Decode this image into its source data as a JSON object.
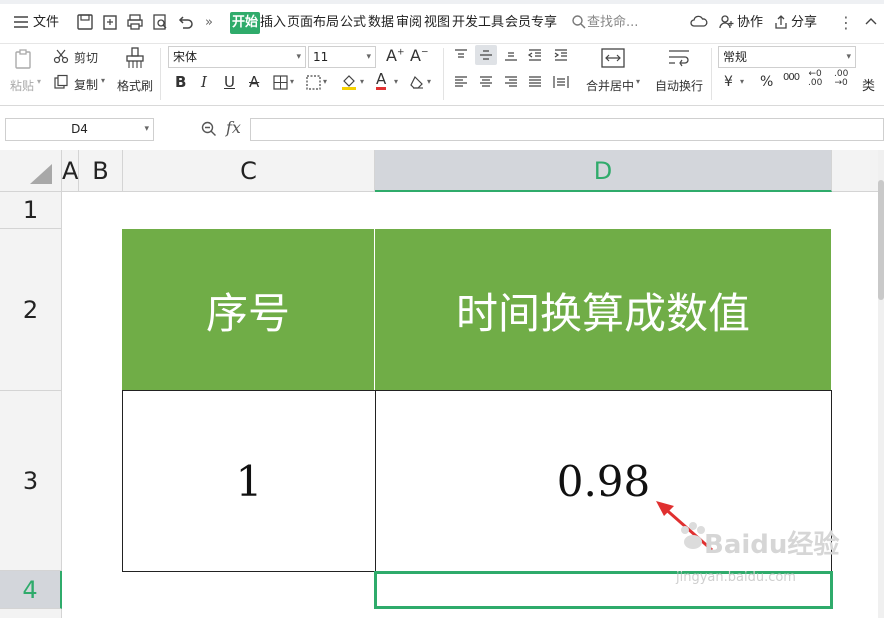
{
  "menubar": {
    "file_label": "文件",
    "more_glyph": "»",
    "tabs": [
      {
        "label": "开始",
        "active": true
      },
      {
        "label": "插入"
      },
      {
        "label": "页面布局"
      },
      {
        "label": "公式"
      },
      {
        "label": "数据"
      },
      {
        "label": "审阅"
      },
      {
        "label": "视图"
      },
      {
        "label": "开发工具"
      },
      {
        "label": "会员专享"
      }
    ],
    "search_placeholder": "查找命...",
    "collab_label": "协作",
    "share_label": "分享",
    "accent_color": "#2fab6b"
  },
  "ribbon": {
    "paste_label": "粘贴",
    "cut_label": "剪切",
    "copy_label": "复制",
    "format_painter_label": "格式刷",
    "font_name": "宋体",
    "font_size": "11",
    "merge_center_label": "合并居中",
    "wrap_text_label": "自动换行",
    "number_format": "常规",
    "currency_glyph": "¥",
    "percent_glyph": "%",
    "thousands_glyph": "000",
    "more_label": "类"
  },
  "formula_bar": {
    "name_box": "D4",
    "fx_label": "fx",
    "formula": ""
  },
  "grid": {
    "columns": [
      "A",
      "B",
      "C",
      "D"
    ],
    "selected_column": "D",
    "rows": [
      "1",
      "2",
      "3",
      "4"
    ],
    "selected_row": "4",
    "table": {
      "header": [
        "序号",
        "时间换算成数值"
      ],
      "row": [
        "1",
        "0.98"
      ],
      "header_color": "#70ad47"
    }
  },
  "watermark": {
    "brand": "Baidu经验",
    "url": "jingyan.baidu.com"
  }
}
